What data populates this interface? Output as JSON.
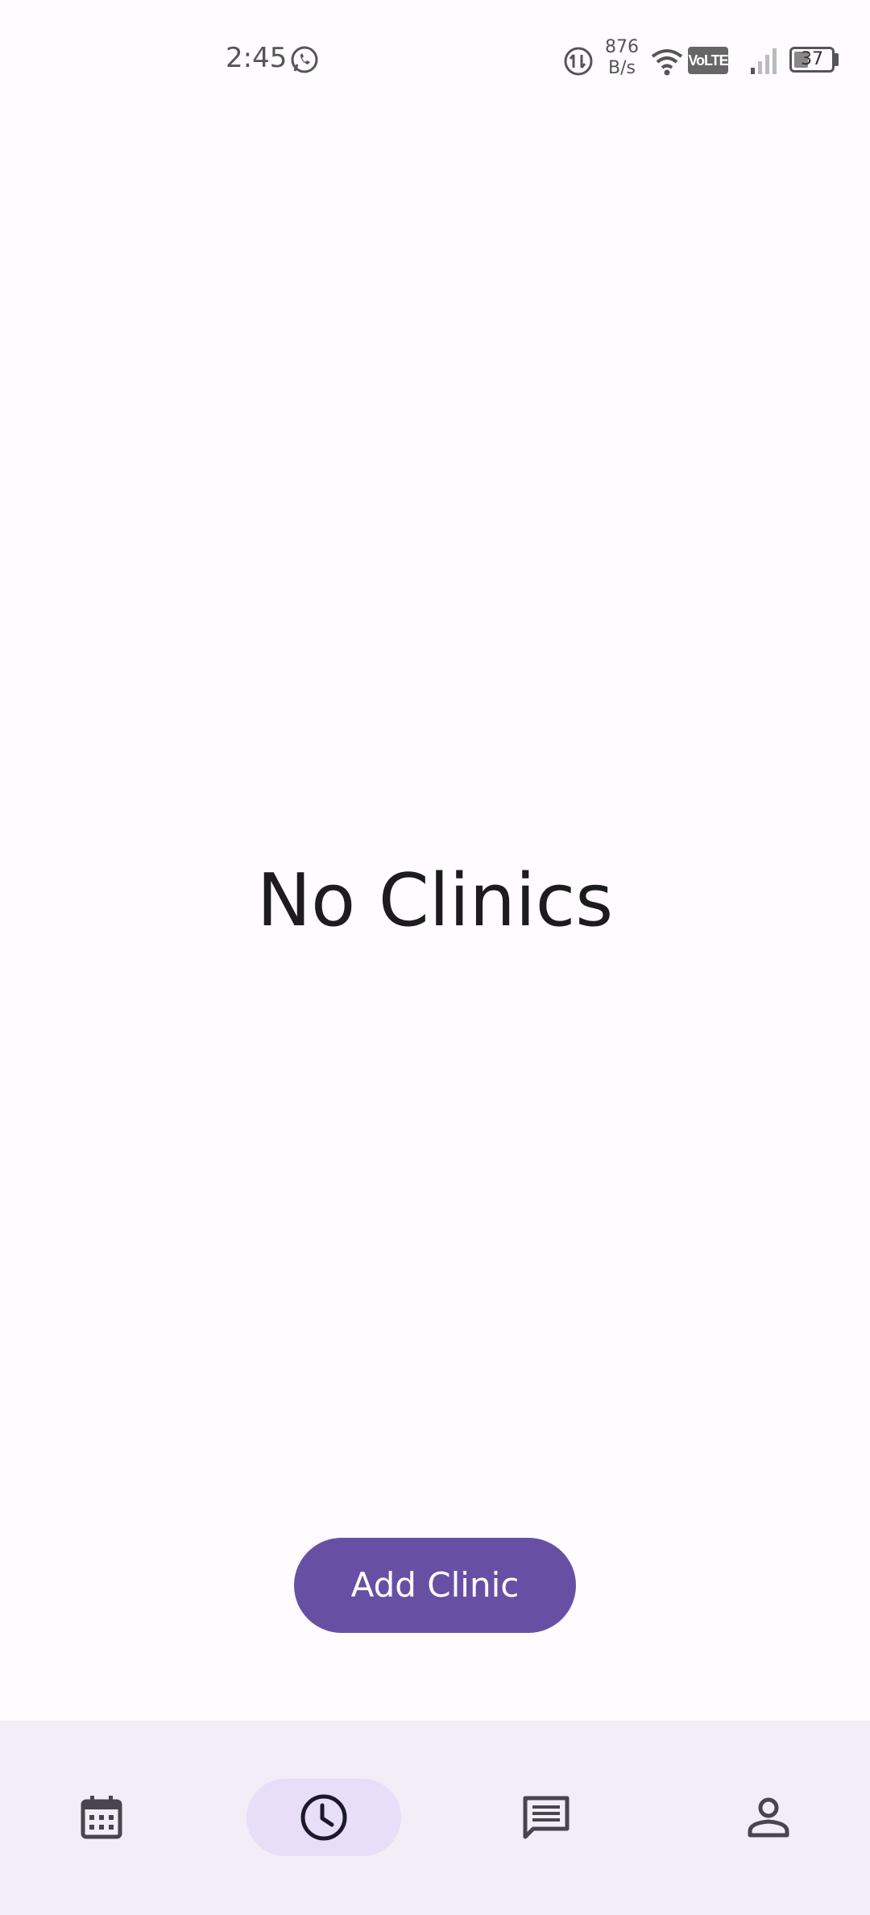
{
  "status_bar": {
    "time": "2:45",
    "net_speed_value": "876",
    "net_speed_unit": "B/s",
    "volte": "VoLTE",
    "battery_level": "37"
  },
  "main": {
    "empty_state_title": "No Clinics"
  },
  "actions": {
    "add_clinic_label": "Add Clinic"
  },
  "bottom_nav": {
    "items": [
      {
        "icon": "calendar-icon",
        "active": false
      },
      {
        "icon": "clock-icon",
        "active": true
      },
      {
        "icon": "chat-icon",
        "active": false
      },
      {
        "icon": "person-icon",
        "active": false
      }
    ]
  },
  "colors": {
    "background": "#fffbfe",
    "primary": "#6750a4",
    "nav_background": "#f3edf7",
    "nav_active_indicator": "#e8def8",
    "on_surface": "#1c1b1f"
  }
}
